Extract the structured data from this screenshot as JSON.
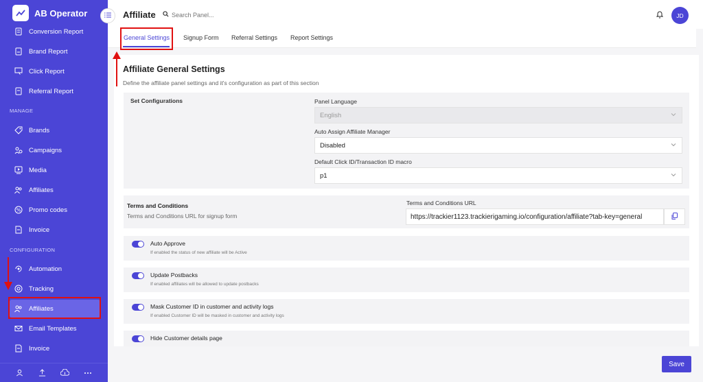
{
  "app": {
    "name": "AB Operator"
  },
  "sidebar": {
    "report_items": [
      {
        "label": "Conversion Report",
        "icon": "report-icon"
      },
      {
        "label": "Brand Report",
        "icon": "report-icon"
      },
      {
        "label": "Click Report",
        "icon": "click-icon"
      },
      {
        "label": "Referral Report",
        "icon": "report-icon"
      }
    ],
    "manage_label": "MANAGE",
    "manage_items": [
      {
        "label": "Brands",
        "icon": "brand-icon"
      },
      {
        "label": "Campaigns",
        "icon": "campaign-icon"
      },
      {
        "label": "Media",
        "icon": "media-icon"
      },
      {
        "label": "Affiliates",
        "icon": "users-icon"
      },
      {
        "label": "Promo codes",
        "icon": "promo-icon"
      },
      {
        "label": "Invoice",
        "icon": "invoice-icon"
      }
    ],
    "configuration_label": "CONFIGURATION",
    "configuration_items": [
      {
        "label": "Automation",
        "icon": "automation-icon"
      },
      {
        "label": "Tracking",
        "icon": "tracking-icon"
      },
      {
        "label": "Affiliates",
        "icon": "users-icon",
        "active": true
      },
      {
        "label": "Email Templates",
        "icon": "email-icon"
      },
      {
        "label": "Invoice",
        "icon": "invoice-icon"
      }
    ],
    "footer_icons": [
      "user-icon",
      "upload-icon",
      "cloud-upload-icon",
      "more-icon"
    ]
  },
  "header": {
    "title": "Affiliate",
    "search_placeholder": "Search Panel...",
    "avatar_initials": "JD"
  },
  "tabs": [
    {
      "label": "General Settings",
      "active": true
    },
    {
      "label": "Signup Form"
    },
    {
      "label": "Referral Settings"
    },
    {
      "label": "Report Settings"
    }
  ],
  "main": {
    "title": "Affiliate General Settings",
    "description": "Define the affiliate panel settings and it's configuration as part of this section",
    "set_configurations": {
      "title": "Set Configurations",
      "panel_language": {
        "label": "Panel Language",
        "value": "English",
        "disabled": true
      },
      "auto_assign": {
        "label": "Auto Assign Affiliate Manager",
        "value": "Disabled"
      },
      "click_macro": {
        "label": "Default Click ID/Transaction ID macro",
        "value": "p1"
      }
    },
    "terms": {
      "title": "Terms and Conditions",
      "description": "Terms and Conditions URL for signup form",
      "url_label": "Terms and Conditions URL",
      "url_value": "https://trackier1123.trackierigaming.io/configuration/affiliate?tab-key=general"
    },
    "toggles": [
      {
        "title": "Auto Approve",
        "description": "If enabled the status of new affiliate will be Active",
        "on": true
      },
      {
        "title": "Update Postbacks",
        "description": "If enabled affiliates will be allowed to update postbacks",
        "on": true
      },
      {
        "title": "Mask Customer ID in customer and activity logs",
        "description": "If enabled Customer ID will be masked in customer and activity logs",
        "on": true
      },
      {
        "title": "Hide Customer details page",
        "description": "",
        "on": true
      }
    ]
  },
  "save_label": "Save",
  "colors": {
    "primary": "#4b45d6",
    "annotation": "#e01010"
  }
}
